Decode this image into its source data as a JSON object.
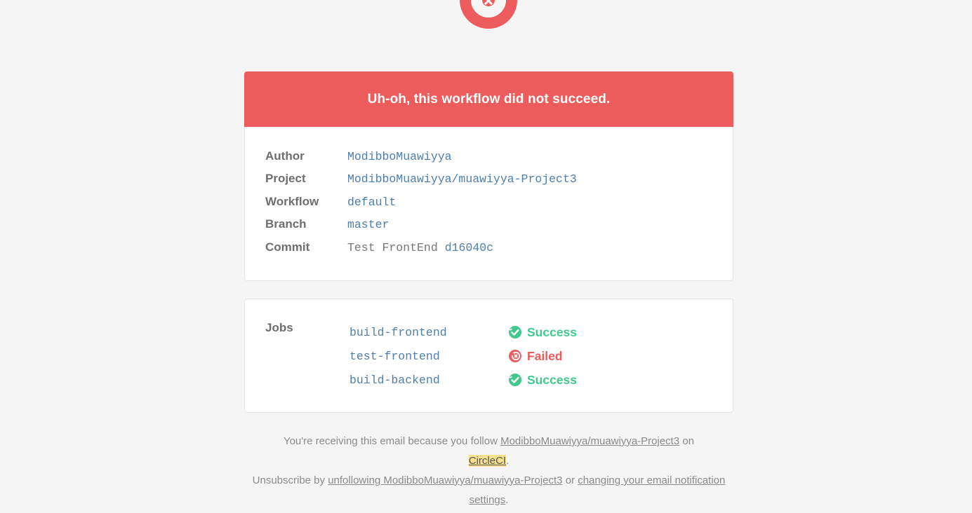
{
  "logo": {
    "icon": "circleci-failed-logo-icon",
    "color": "#ed5c5c"
  },
  "banner": {
    "text": "Uh-oh, this workflow did not succeed.",
    "color": "#ed5c5c"
  },
  "details": [
    {
      "label": "Author",
      "value": "ModibboMuawiyya"
    },
    {
      "label": "Project",
      "value": "ModibboMuawiyya/muawiyya-Project3"
    },
    {
      "label": "Workflow",
      "value": "default"
    },
    {
      "label": "Branch",
      "value": "master"
    }
  ],
  "commit": {
    "label": "Commit",
    "message": "Test FrontEnd",
    "sha": "d16040c"
  },
  "jobs": {
    "label": "Jobs",
    "items": [
      {
        "name": "build-frontend",
        "status": "Success",
        "icon": "success-check-icon"
      },
      {
        "name": "test-frontend",
        "status": "Failed",
        "icon": "failed-x-icon"
      },
      {
        "name": "build-backend",
        "status": "Success",
        "icon": "success-check-icon"
      }
    ]
  },
  "footer": {
    "line1_prefix": "You're receiving this email because you follow",
    "follow_link": "ModibboMuawiyya/muawiyya-Project3",
    "line1_mid": "on",
    "circleci_link": "CircleCI",
    "line1_end": ".",
    "line2_prefix": "Unsubscribe by",
    "unfollow_link": "unfollowing ModibboMuawiyya/muawiyya-Project3",
    "line2_mid": "or",
    "settings_link": "changing your email notification settings",
    "line2_end": "."
  },
  "colors": {
    "success": "#42c88a",
    "failed": "#ed5c5c",
    "link": "#4e7fab"
  }
}
